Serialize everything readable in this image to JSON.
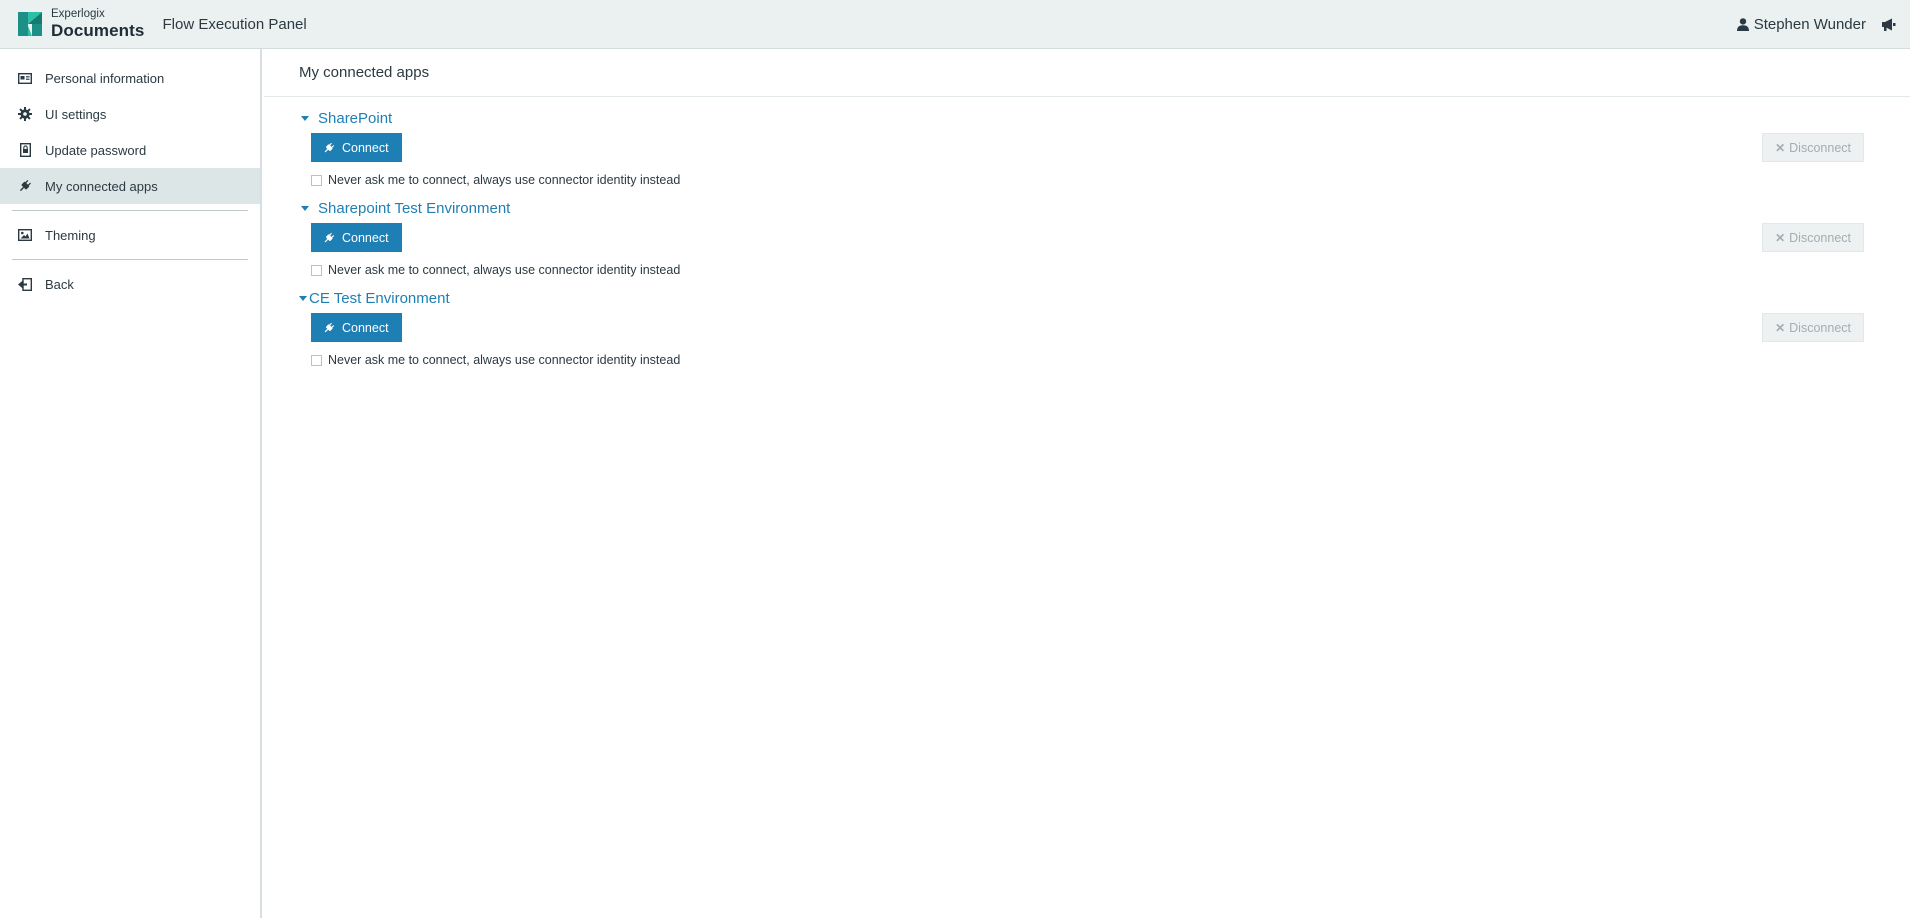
{
  "header": {
    "logo_small": "Experlogix",
    "logo_big": "Documents",
    "app_title": "Flow Execution Panel",
    "user_name": "Stephen Wunder",
    "user_icon": "user-icon",
    "announce_icon": "megaphone-icon"
  },
  "sidebar": {
    "items": [
      {
        "label": "Personal information",
        "icon": "id-card-icon",
        "active": false
      },
      {
        "label": "UI settings",
        "icon": "gear-icon",
        "active": false
      },
      {
        "label": "Update password",
        "icon": "lock-icon",
        "active": false
      },
      {
        "label": "My connected apps",
        "icon": "plug-icon",
        "active": true
      },
      {
        "label": "Theming",
        "icon": "image-icon",
        "active": false
      },
      {
        "label": "Back",
        "icon": "back-arrow-icon",
        "active": false
      }
    ]
  },
  "main": {
    "page_title": "My connected apps",
    "apps": [
      {
        "name": "SharePoint",
        "connect_label": "Connect",
        "disconnect_label": "Disconnect",
        "checkbox_label": "Never ask me to connect, always use connector identity instead",
        "checked": false
      },
      {
        "name": "Sharepoint Test Environment",
        "connect_label": "Connect",
        "disconnect_label": "Disconnect",
        "checkbox_label": "Never ask me to connect, always use connector identity instead",
        "checked": false
      },
      {
        "name": "CE Test Environment",
        "connect_label": "Connect",
        "disconnect_label": "Disconnect",
        "checkbox_label": "Never ask me to connect, always use connector identity instead",
        "checked": false
      }
    ]
  },
  "colors": {
    "accent": "#1e7fb5",
    "header_bg": "#ebf0f0",
    "active_nav_bg": "#dde6e7",
    "disabled_text": "#a4adb1"
  }
}
